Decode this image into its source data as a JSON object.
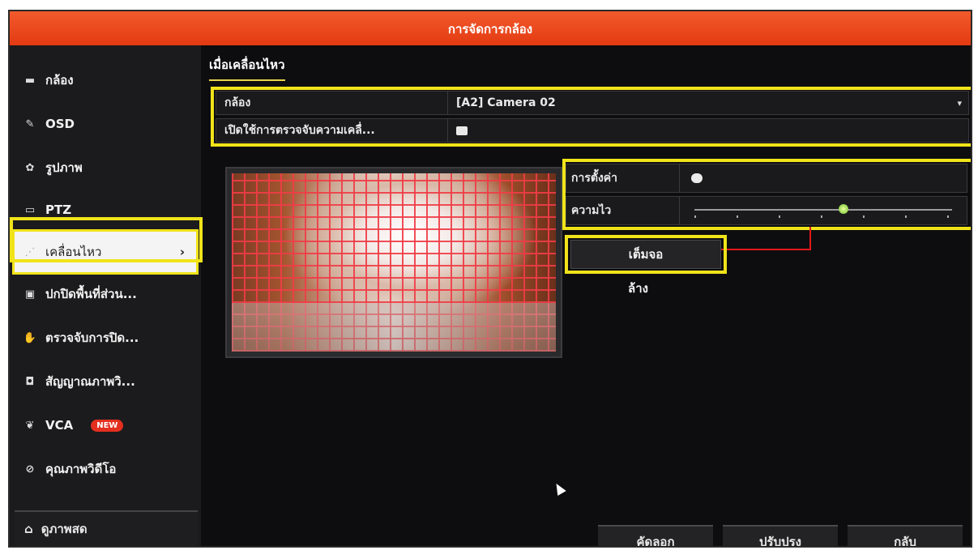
{
  "window": {
    "title": "การจัดการกล้อง"
  },
  "sidebar": {
    "items": [
      {
        "label": "กล้อง",
        "icon": "camera-icon"
      },
      {
        "label": "OSD",
        "icon": "brush-icon"
      },
      {
        "label": "รูปภาพ",
        "icon": "palette-icon"
      },
      {
        "label": "PTZ",
        "icon": "ptz-icon"
      },
      {
        "label": "เคลื่อนไหว",
        "icon": "motion-icon",
        "active": true
      },
      {
        "label": "ปกปิดพื้นที่ส่วน...",
        "icon": "privacy-mask-icon"
      },
      {
        "label": "ตรวจจับการปิด...",
        "icon": "hand-icon"
      },
      {
        "label": "สัญญาณภาพวิ...",
        "icon": "video-loss-icon"
      },
      {
        "label": "VCA",
        "icon": "vca-icon",
        "badge": "NEW"
      },
      {
        "label": "คุณภาพวิดีโอ",
        "icon": "quality-icon"
      }
    ],
    "live_view": {
      "label": "ดูภาพสด",
      "icon": "home-icon"
    }
  },
  "main": {
    "tab": "เมื่อเคลื่อนไหว",
    "camera_label": "กล้อง",
    "camera_value": "[A2] Camera 02",
    "enable_label": "เปิดใช้การตรวจจับความเคลื่...",
    "enable_checked": true,
    "settings_label": "การตั้งค่า",
    "sensitivity_label": "ความไว",
    "sensitivity_level": 0.58,
    "fullscreen_label": "เต็มจอ",
    "clear_label": "ล้าง"
  },
  "footer": {
    "copy_label": "คัดลอก",
    "apply_label": "ปรับปรุง",
    "back_label": "กลับ"
  },
  "colors": {
    "accent": "#e8401a",
    "highlight": "#f0e31a",
    "grid": "#f03c46",
    "arrow": "#e21818"
  }
}
